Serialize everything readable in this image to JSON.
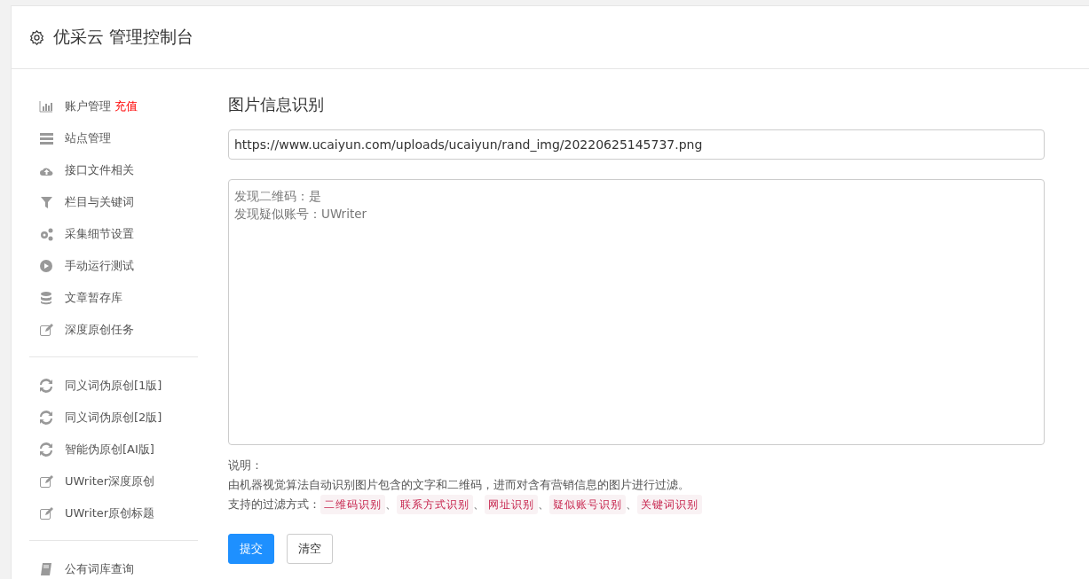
{
  "header": {
    "title": "优采云 管理控制台"
  },
  "sidebar": {
    "groups": [
      {
        "items": [
          {
            "label": "账户管理",
            "badge": "充值"
          },
          {
            "label": "站点管理"
          },
          {
            "label": "接口文件相关"
          },
          {
            "label": "栏目与关键词"
          },
          {
            "label": "采集细节设置"
          },
          {
            "label": "手动运行测试"
          },
          {
            "label": "文章暂存库"
          },
          {
            "label": "深度原创任务"
          }
        ]
      },
      {
        "items": [
          {
            "label": "同义词伪原创[1版]"
          },
          {
            "label": "同义词伪原创[2版]"
          },
          {
            "label": "智能伪原创[AI版]"
          },
          {
            "label": "UWriter深度原创"
          },
          {
            "label": "UWriter原创标题"
          }
        ]
      },
      {
        "items": [
          {
            "label": "公有词库查询"
          }
        ]
      }
    ]
  },
  "main": {
    "title": "图片信息识别",
    "url_field": {
      "value": "https://www.ucaiyun.com/uploads/ucaiyun/rand_img/20220625145737.png"
    },
    "result_box": {
      "lines": [
        "发现二维码：是",
        "发现疑似账号：UWriter"
      ]
    },
    "note_label": "说明：",
    "description": "由机器视觉算法自动识别图片包含的文字和二维码，进而对含有营销信息的图片进行过滤。",
    "filters_label": "支持的过滤方式：",
    "filters": [
      "二维码识别",
      "联系方式识别",
      "网址识别",
      "疑似账号识别",
      "关键词识别"
    ],
    "separator": "、",
    "buttons": [
      {
        "label": "提交",
        "kind": "primary"
      },
      {
        "label": "清空",
        "kind": "default"
      }
    ]
  }
}
